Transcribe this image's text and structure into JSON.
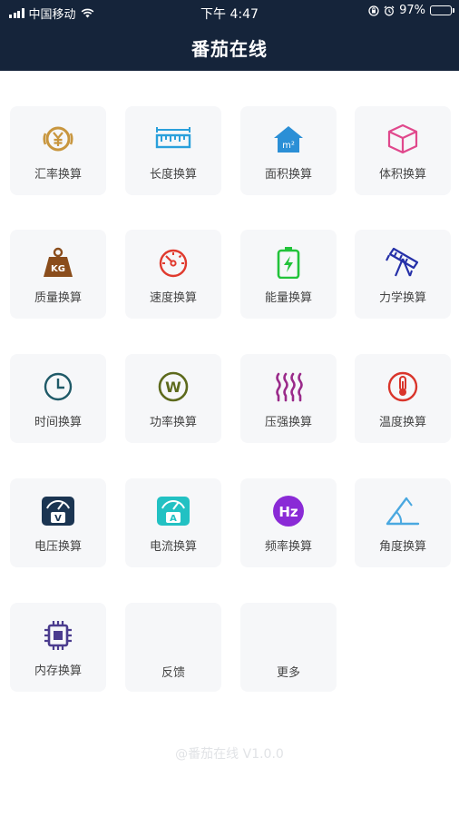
{
  "status_bar": {
    "carrier": "中国移动",
    "time": "下午 4:47",
    "battery": "97%"
  },
  "header": {
    "title": "番茄在线"
  },
  "tools": [
    {
      "label": "汇率换算",
      "icon": "currency-icon",
      "color": "#c8963e"
    },
    {
      "label": "长度换算",
      "icon": "ruler-icon",
      "color": "#2aa0db"
    },
    {
      "label": "面积换算",
      "icon": "area-house-icon",
      "color": "#2b8fd6",
      "icon_text": "m²"
    },
    {
      "label": "体积换算",
      "icon": "cube-icon",
      "color": "#e0488c"
    },
    {
      "label": "质量换算",
      "icon": "weight-kg-icon",
      "color": "#8a4d1c",
      "icon_text": "KG"
    },
    {
      "label": "速度换算",
      "icon": "speedometer-icon",
      "color": "#e03a2e"
    },
    {
      "label": "能量换算",
      "icon": "battery-bolt-icon",
      "color": "#22c33a"
    },
    {
      "label": "力学换算",
      "icon": "telescope-icon",
      "color": "#2530a8"
    },
    {
      "label": "时间换算",
      "icon": "clock-icon",
      "color": "#1f5a68"
    },
    {
      "label": "功率换算",
      "icon": "watt-icon",
      "color": "#5d6a1c",
      "icon_text": "W"
    },
    {
      "label": "压强换算",
      "icon": "heat-waves-icon",
      "color": "#9a2a8a"
    },
    {
      "label": "温度换算",
      "icon": "thermometer-icon",
      "color": "#d9352b"
    },
    {
      "label": "电压换算",
      "icon": "voltmeter-icon",
      "color": "#1b3552",
      "icon_text": "V"
    },
    {
      "label": "电流换算",
      "icon": "ammeter-icon",
      "color": "#22c1c3",
      "icon_text": "A"
    },
    {
      "label": "频率换算",
      "icon": "hertz-icon",
      "color": "#8a2ad6",
      "icon_text": "Hz"
    },
    {
      "label": "角度换算",
      "icon": "angle-icon",
      "color": "#4aa8e0"
    },
    {
      "label": "内存换算",
      "icon": "chip-icon",
      "color": "#4b3c8e"
    },
    {
      "label": "反馈",
      "icon": "",
      "color": ""
    },
    {
      "label": "更多",
      "icon": "",
      "color": ""
    }
  ],
  "footer": {
    "text": "@番茄在线 V1.0.0"
  }
}
